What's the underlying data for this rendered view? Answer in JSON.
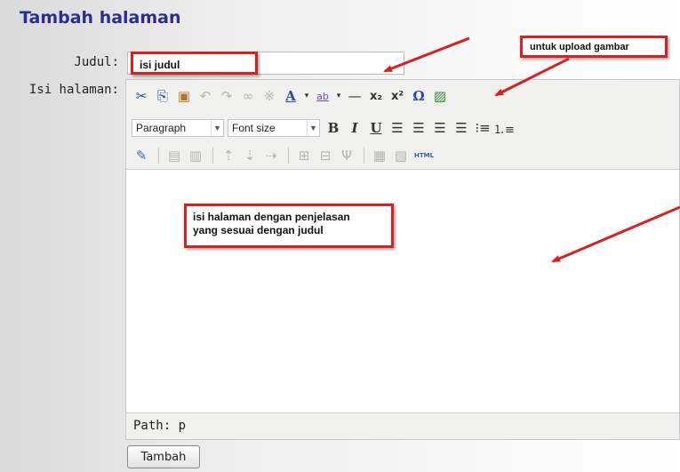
{
  "page": {
    "title": "Tambah halaman"
  },
  "form": {
    "judul_label": "Judul:",
    "judul_value": "isi judul",
    "isi_label": "Isi halaman:",
    "submit_label": "Tambah"
  },
  "editor": {
    "paragraph_select": "Paragraph",
    "fontsize_select": "Font size",
    "status_path": "Path: p",
    "toolbar_row1": [
      "cut",
      "copy",
      "paste",
      "undo",
      "redo",
      "link",
      "unlink",
      "font-color",
      "highlight",
      "horizontal-rule",
      "subscript",
      "superscript",
      "special-char",
      "image-upload"
    ],
    "toolbar_row2": [
      "bold",
      "italic",
      "underline",
      "align-left",
      "align-center",
      "align-right",
      "align-justify",
      "bullet-list",
      "numbered-list"
    ],
    "toolbar_row3": [
      "edit",
      "table-row",
      "table-col",
      "insert-row",
      "delete-row",
      "insert-col",
      "merge",
      "split",
      "table",
      "table-props",
      "html"
    ]
  },
  "annotations": {
    "judul_hint": "isi judul",
    "upload_hint": "untuk upload gambar",
    "isi_hint_line1": "isi halaman dengan penjelasan",
    "isi_hint_line2": "yang sesuai dengan judul"
  },
  "colors": {
    "title": "#2b2f8f",
    "callout_border": "#d92020",
    "arrow": "#d92020"
  }
}
